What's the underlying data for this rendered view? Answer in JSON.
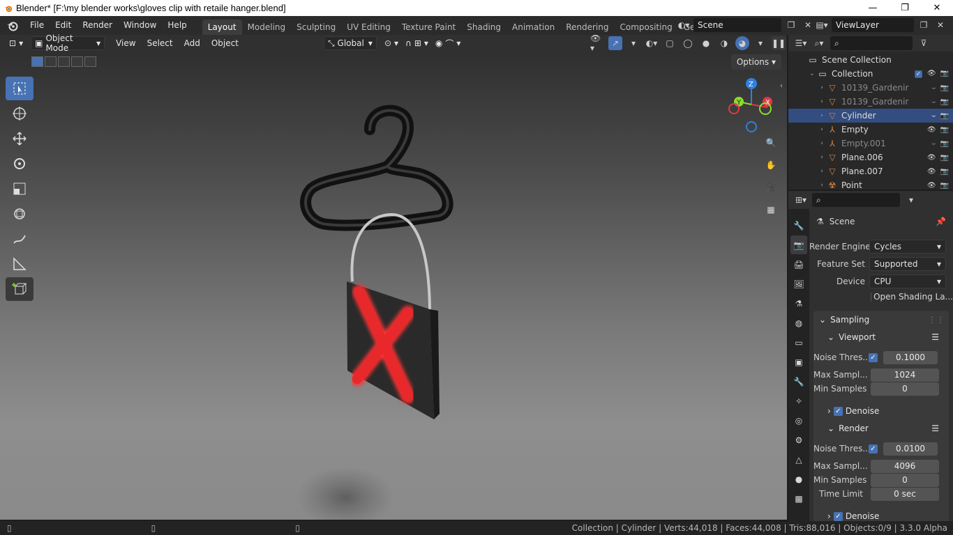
{
  "window": {
    "title": "Blender* [F:\\my blender works\\gloves clip with retaile hanger.blend]",
    "minimize_glyph": "—",
    "restore_glyph": "❐",
    "close_glyph": "✕"
  },
  "menu": [
    "File",
    "Edit",
    "Render",
    "Window",
    "Help"
  ],
  "workspaces": [
    "Layout",
    "Modeling",
    "Sculpting",
    "UV Editing",
    "Texture Paint",
    "Shading",
    "Animation",
    "Rendering",
    "Compositing",
    "Geometry Noc"
  ],
  "active_workspace": "Layout",
  "scene_field": "Scene",
  "view_layer_field": "ViewLayer",
  "viewport_header": {
    "mode": "Object Mode",
    "menus": [
      "View",
      "Select",
      "Add",
      "Object"
    ],
    "orientation": "Global"
  },
  "options_label": "Options",
  "outliner": {
    "search_placeholder": "",
    "rows": [
      {
        "name": "Scene Collection",
        "depth": 0,
        "icon": "scene-collection-icon",
        "state": "normal"
      },
      {
        "name": "Collection",
        "depth": 1,
        "icon": "collection-icon",
        "state": "normal"
      },
      {
        "name": "10139_Gardenir",
        "depth": 2,
        "icon": "mesh-icon",
        "state": "dim"
      },
      {
        "name": "10139_Gardenir",
        "depth": 2,
        "icon": "mesh-icon",
        "state": "dim"
      },
      {
        "name": "Cylinder",
        "depth": 2,
        "icon": "mesh-icon",
        "state": "selected"
      },
      {
        "name": "Empty",
        "depth": 2,
        "icon": "empty-icon",
        "state": "normal"
      },
      {
        "name": "Empty.001",
        "depth": 2,
        "icon": "empty-icon",
        "state": "dim"
      },
      {
        "name": "Plane.006",
        "depth": 2,
        "icon": "mesh-icon",
        "state": "normal"
      },
      {
        "name": "Plane.007",
        "depth": 2,
        "icon": "mesh-icon",
        "state": "normal"
      },
      {
        "name": "Point",
        "depth": 2,
        "icon": "light-icon",
        "state": "normal"
      }
    ],
    "empty_child_count": "3"
  },
  "properties": {
    "context": "Scene",
    "render_engine_label": "Render Engine",
    "render_engine": "Cycles",
    "feature_set_label": "Feature Set",
    "feature_set": "Supported",
    "device_label": "Device",
    "device": "CPU",
    "osl_label": "Open Shading La...",
    "sampling_label": "Sampling",
    "viewport_label": "Viewport",
    "render_label": "Render",
    "noise_threshold_label": "Noise Thres...",
    "max_samples_label": "Max Sampl...",
    "min_samples_label": "Min Samples",
    "time_limit_label": "Time Limit",
    "denoise_label": "Denoise",
    "viewport_noise_threshold": "0.1000",
    "viewport_max_samples": "1024",
    "viewport_min_samples": "0",
    "render_noise_threshold": "0.0100",
    "render_max_samples": "4096",
    "render_min_samples": "0",
    "render_time_limit": "0 sec"
  },
  "status": "Collection | Cylinder | Verts:44,018 | Faces:44,008 | Tris:88,016 | Objects:0/9 | 3.3.0 Alpha",
  "colors": {
    "accent": "#4772b3",
    "selected_row": "#334d80",
    "x_mark": "#e8282a",
    "gizmo_x": "#e6344a",
    "gizmo_y": "#8bdc2e",
    "gizmo_z": "#2f7fe0"
  }
}
